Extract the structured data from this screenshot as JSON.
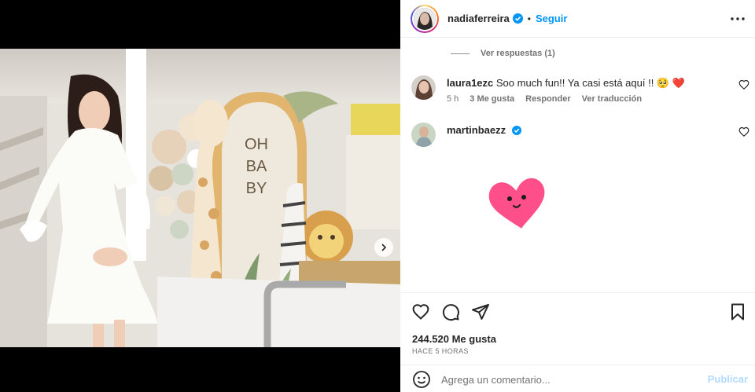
{
  "post": {
    "username": "nadiaferreira",
    "separator": "•",
    "follow_label": "Seguir",
    "more_icon": "more-horizontal-icon"
  },
  "image": {
    "decor_text": [
      "OH",
      "BA",
      "BY"
    ],
    "next_icon": "chevron-right-icon",
    "carousel_count": 3,
    "carousel_active": 1
  },
  "comments": {
    "view_replies_label": "Ver respuestas (1)",
    "items": [
      {
        "username": "laura1ezc",
        "text": "Soo much fun!! Ya casi está aquí !! 🥺 ❤️",
        "time": "5 h",
        "likes": "3 Me gusta",
        "reply": "Responder",
        "translate": "Ver traducción"
      },
      {
        "username": "martinbaezz",
        "sticker": "pink-heart-face-sticker"
      }
    ]
  },
  "actions": {
    "likes": "244.520 Me gusta",
    "timestamp": "HACE 5 HORAS"
  },
  "comment_box": {
    "placeholder": "Agrega un comentario...",
    "post_label": "Publicar"
  },
  "colors": {
    "accent": "#0095f6",
    "post_disabled": "#b3dbff",
    "sticker_pink": "#ff4f8b"
  }
}
